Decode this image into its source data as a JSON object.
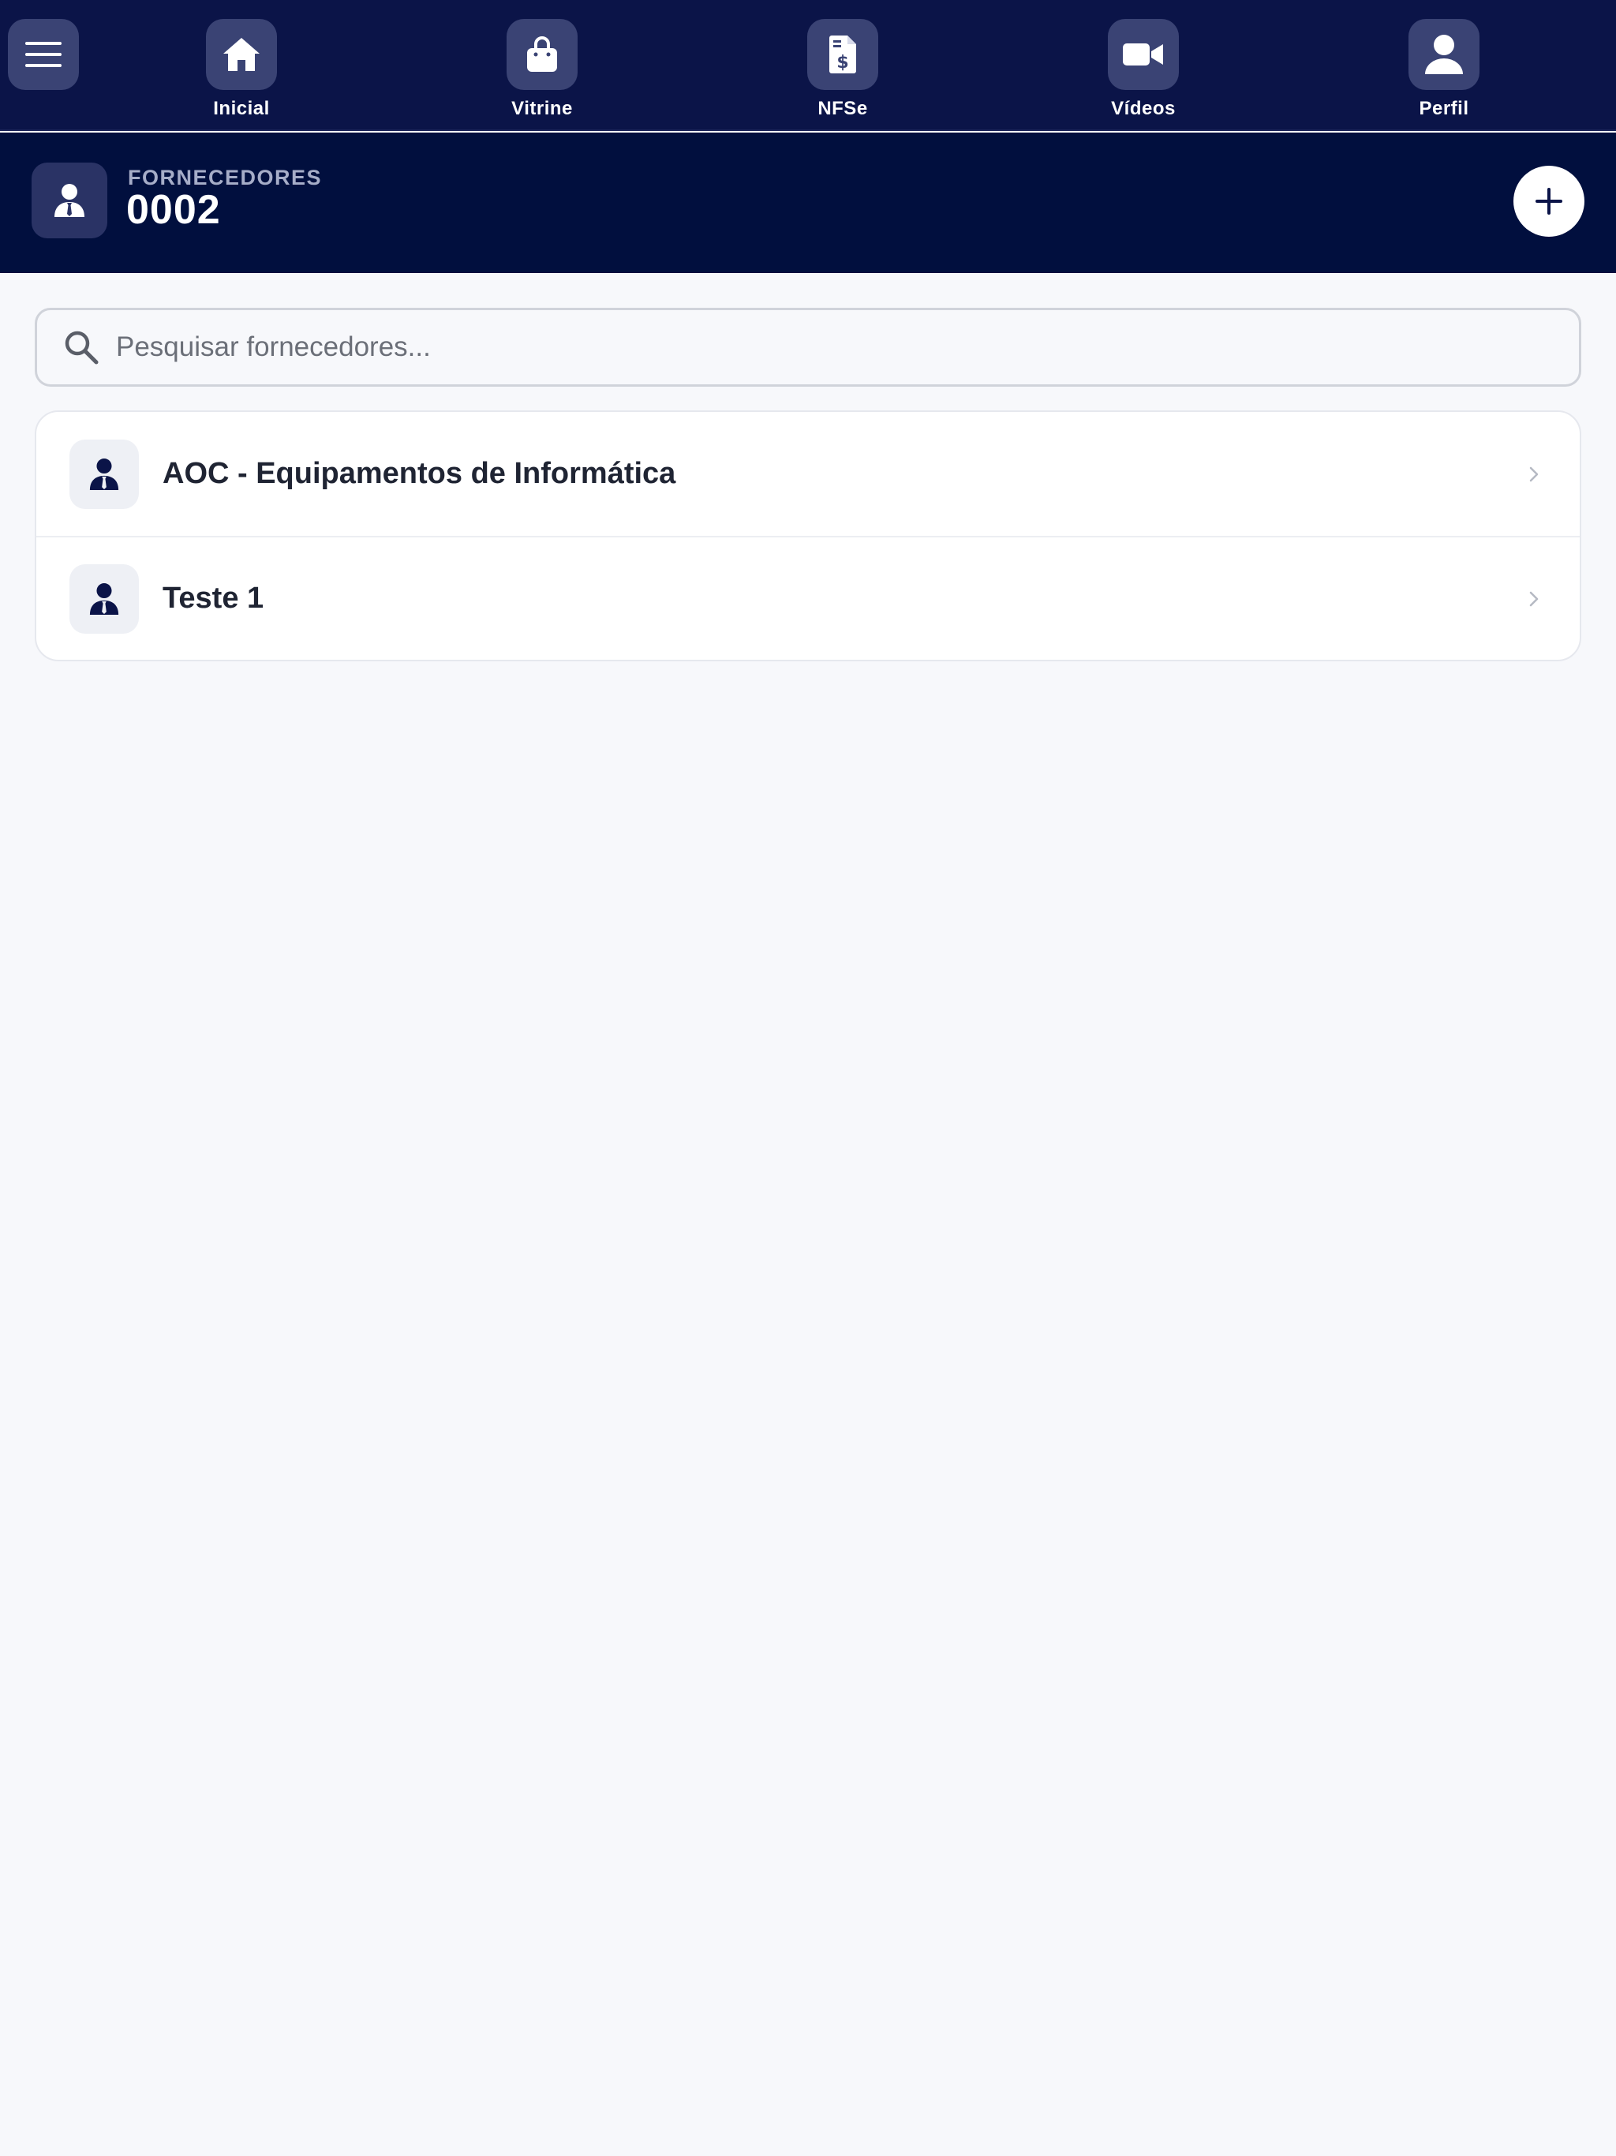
{
  "nav": {
    "items": [
      {
        "label": "Inicial",
        "icon": "home-icon"
      },
      {
        "label": "Vitrine",
        "icon": "shopping-bag-icon"
      },
      {
        "label": "NFSe",
        "icon": "invoice-icon"
      },
      {
        "label": "Vídeos",
        "icon": "video-camera-icon"
      },
      {
        "label": "Perfil",
        "icon": "user-icon"
      }
    ]
  },
  "header": {
    "label": "FORNECEDORES",
    "count": "0002"
  },
  "search": {
    "placeholder": "Pesquisar fornecedores...",
    "value": ""
  },
  "suppliers": [
    {
      "name": "AOC - Equipamentos de Informática"
    },
    {
      "name": "Teste 1"
    }
  ],
  "colors": {
    "nav_bg": "#0b1448",
    "header_bg": "#010f3e",
    "accent": "#0b1448",
    "page_bg": "#f7f8fb"
  }
}
